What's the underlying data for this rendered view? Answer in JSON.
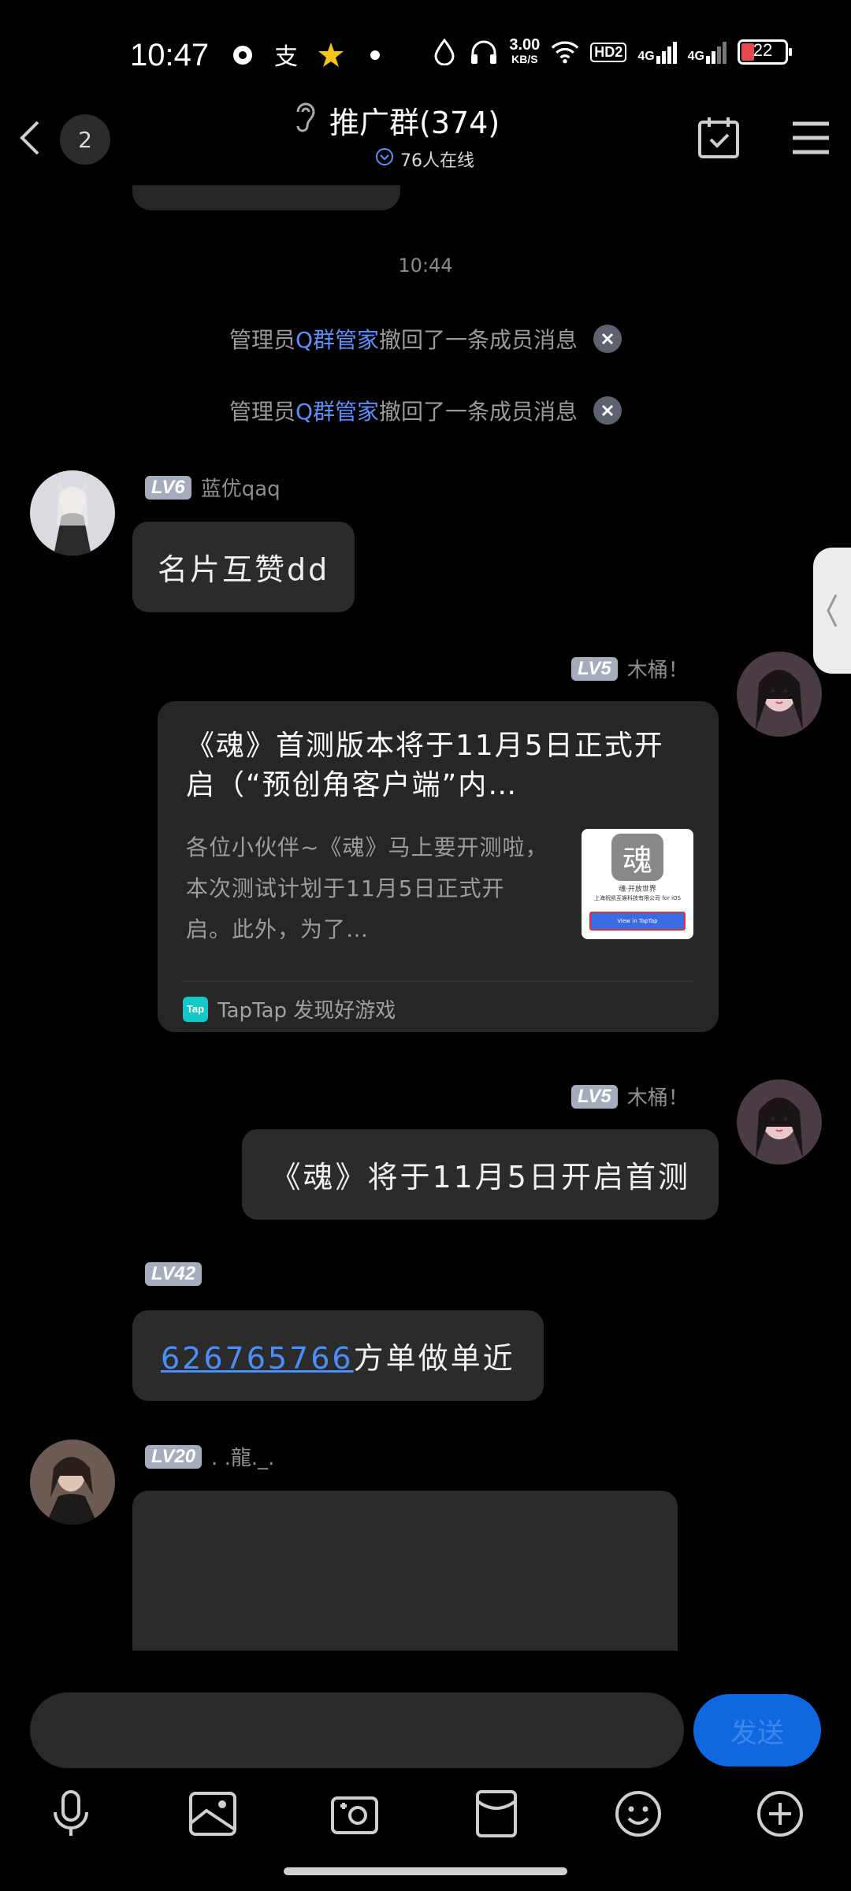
{
  "status_bar": {
    "time": "10:47",
    "speed_value": "3.00",
    "speed_unit": "KB/S",
    "hd": "HD2",
    "net1": "4G",
    "net2": "4G",
    "battery": "22"
  },
  "header": {
    "unread_count": "2",
    "group_name": "推广群(374)",
    "online_text": "76人在线"
  },
  "chat": {
    "timestamp": "10:44",
    "system_messages": [
      {
        "prefix": "管理员",
        "actor": "Q群管家",
        "suffix": "撤回了一条成员消息"
      },
      {
        "prefix": "管理员",
        "actor": "Q群管家",
        "suffix": "撤回了一条成员消息"
      }
    ],
    "messages": [
      {
        "level": "LV6",
        "nickname": "蓝优qaq",
        "text": "名片互赞dd"
      },
      {
        "level": "LV5",
        "nickname": "木桶！",
        "card": {
          "title": "《魂》首测版本将于11月5日正式开启（“预创角客户端”内…",
          "description": "各位小伙伴~《魂》马上要开测啦，本次测试计划于11月5日正式开启。此外，为了…",
          "source": "TapTap 发现好游戏",
          "source_icon_text": "Tap",
          "thumb_title": "魂",
          "thumb_line1": "魂·开放世界",
          "thumb_line2": "上海祝凯互娱科技有限公司 for iOS",
          "thumb_button": "View in TapTap"
        }
      },
      {
        "level": "LV5",
        "nickname": "木桶！",
        "text": "《魂》将于11月5日开启首测"
      },
      {
        "level": "LV42",
        "link": "626765766",
        "text_after_link": "方单做单近"
      },
      {
        "level": "LV20",
        "nickname": ". .龍._."
      }
    ]
  },
  "input": {
    "send_label": "发送"
  },
  "colors": {
    "accent": "#1068e0",
    "link": "#4c8df6",
    "bubble": "#2b2b2b",
    "level_badge": "#a4acbd"
  }
}
